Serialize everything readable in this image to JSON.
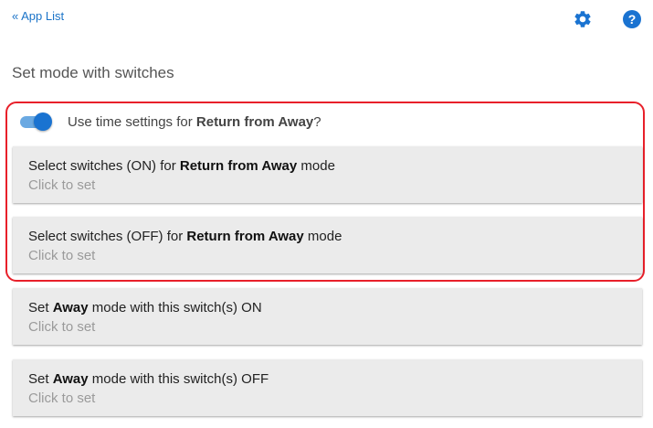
{
  "nav": {
    "back_label": "« App List"
  },
  "icons": {
    "settings": "gear-icon",
    "help": "help-icon",
    "accent_color": "#1a73d1"
  },
  "section": {
    "title": "Set mode with switches"
  },
  "toggle": {
    "state": "on",
    "prefix": "Use time settings for ",
    "bold": "Return from Away",
    "suffix": "?"
  },
  "highlight_color": "#e8202a",
  "cards": [
    {
      "prefix": "Select switches (ON) for ",
      "bold": "Return from Away",
      "suffix": " mode",
      "sub": "Click to set"
    },
    {
      "prefix": "Select switches (OFF) for ",
      "bold": "Return from Away",
      "suffix": " mode",
      "sub": "Click to set"
    },
    {
      "prefix": "Set ",
      "bold": "Away",
      "suffix": " mode with this switch(s) ON",
      "sub": "Click to set"
    },
    {
      "prefix": "Set ",
      "bold": "Away",
      "suffix": " mode with this switch(s) OFF",
      "sub": "Click to set"
    }
  ]
}
